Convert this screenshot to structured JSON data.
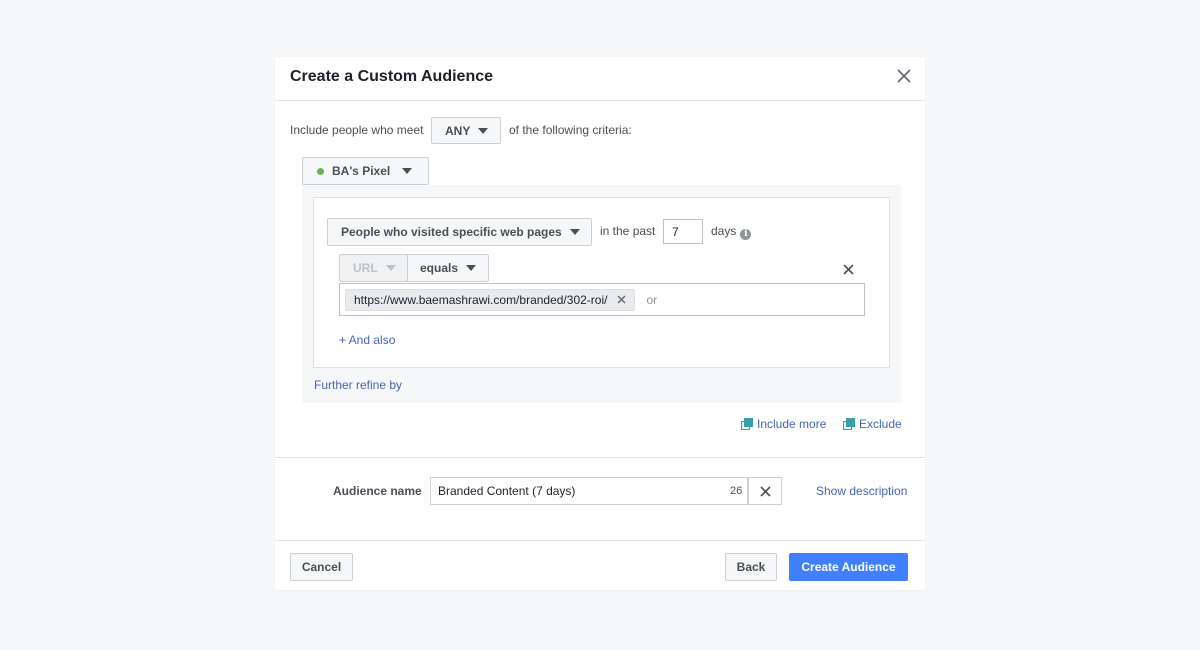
{
  "modal": {
    "title": "Create a Custom Audience"
  },
  "criteria": {
    "prefix": "Include people who meet",
    "match_value": "ANY",
    "suffix": "of the following criteria:"
  },
  "pixel": {
    "name": "BA's Pixel",
    "status_color": "#6ab04c"
  },
  "rule": {
    "event": "People who visited specific web pages",
    "in_the_past_label": "in the past",
    "days_value": "7",
    "days_label": "days",
    "info_glyph": "i",
    "field": "URL",
    "operator": "equals",
    "url_token": "https://www.baemashrawi.com/branded/302-roi/",
    "or_label": "or",
    "and_also": "+ And also"
  },
  "refine": {
    "label": "Further refine by"
  },
  "actions": {
    "include_more": "Include more",
    "exclude": "Exclude"
  },
  "audience_name": {
    "label": "Audience name",
    "value": "Branded Content (7 days)",
    "char_count": "26",
    "show_description": "Show description"
  },
  "footer": {
    "cancel": "Cancel",
    "back": "Back",
    "create": "Create Audience"
  },
  "colors": {
    "primary": "#4080ff",
    "link": "#4267b2",
    "teal": "#37a2a6"
  }
}
